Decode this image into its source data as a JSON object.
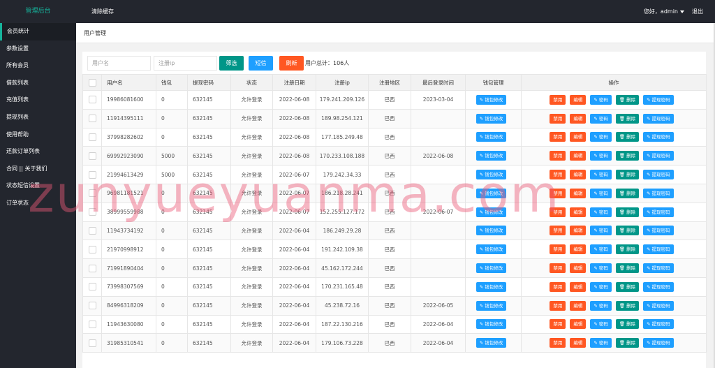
{
  "header": {
    "logo": "管理后台",
    "clear_cache": "清除缓存",
    "greeting": "您好，admin",
    "logout": "退出"
  },
  "sidebar": {
    "items": [
      {
        "label": "会员统计",
        "active": true
      },
      {
        "label": "参数设置"
      },
      {
        "label": "所有会员"
      },
      {
        "label": "借款列表"
      },
      {
        "label": "充值列表"
      },
      {
        "label": "提现列表"
      },
      {
        "label": "使用帮助"
      },
      {
        "label": "还款订单列表"
      },
      {
        "label": "合同 || 关于我们"
      },
      {
        "label": "状态短信设置"
      },
      {
        "label": "订单状态"
      }
    ]
  },
  "tab": {
    "title": "用户管理"
  },
  "toolbar": {
    "username_placeholder": "用户名",
    "ip_placeholder": "注册ip",
    "filter_label": "筛选",
    "sms_label": "短信",
    "refresh_label": "刷新",
    "total_text": "用户总计：106人"
  },
  "table": {
    "headers": [
      "用户名",
      "钱包",
      "提现密码",
      "状态",
      "注册日期",
      "注册ip",
      "注册地区",
      "最后登录时间",
      "钱包管理",
      "操作"
    ],
    "actions": {
      "wallet_edit": "钱包修改",
      "disable": "禁用",
      "edit": "编辑",
      "password": "密码",
      "delete": "删除",
      "withdraw_password": "提现密码"
    },
    "rows": [
      {
        "username": "19986081600",
        "wallet": "0",
        "withdraw_pwd": "632145",
        "status": "允许登录",
        "reg_date": "2022-06-08",
        "reg_ip": "179.241.209.126",
        "region": "巴西",
        "last_login": "2023-03-04"
      },
      {
        "username": "11914395111",
        "wallet": "0",
        "withdraw_pwd": "632145",
        "status": "允许登录",
        "reg_date": "2022-06-08",
        "reg_ip": "189.98.254.121",
        "region": "巴西",
        "last_login": ""
      },
      {
        "username": "37998282602",
        "wallet": "0",
        "withdraw_pwd": "632145",
        "status": "允许登录",
        "reg_date": "2022-06-08",
        "reg_ip": "177.185.249.48",
        "region": "巴西",
        "last_login": ""
      },
      {
        "username": "69992923090",
        "wallet": "5000",
        "withdraw_pwd": "632145",
        "status": "允许登录",
        "reg_date": "2022-06-08",
        "reg_ip": "170.233.108.188",
        "region": "巴西",
        "last_login": "2022-06-08"
      },
      {
        "username": "21994613429",
        "wallet": "5000",
        "withdraw_pwd": "632145",
        "status": "允许登录",
        "reg_date": "2022-06-07",
        "reg_ip": "179.242.34.33",
        "region": "巴西",
        "last_login": ""
      },
      {
        "username": "96981181521",
        "wallet": "0",
        "withdraw_pwd": "632145",
        "status": "允许登录",
        "reg_date": "2022-06-07",
        "reg_ip": "186.218.28.241",
        "region": "巴西",
        "last_login": ""
      },
      {
        "username": "38999559988",
        "wallet": "0",
        "withdraw_pwd": "632145",
        "status": "允许登录",
        "reg_date": "2022-06-07",
        "reg_ip": "152.255.127.172",
        "region": "巴西",
        "last_login": "2022-06-07"
      },
      {
        "username": "11943734192",
        "wallet": "0",
        "withdraw_pwd": "632145",
        "status": "允许登录",
        "reg_date": "2022-06-04",
        "reg_ip": "186.249.29.28",
        "region": "巴西",
        "last_login": ""
      },
      {
        "username": "21970998912",
        "wallet": "0",
        "withdraw_pwd": "632145",
        "status": "允许登录",
        "reg_date": "2022-06-04",
        "reg_ip": "191.242.109.38",
        "region": "巴西",
        "last_login": ""
      },
      {
        "username": "71991890404",
        "wallet": "0",
        "withdraw_pwd": "632145",
        "status": "允许登录",
        "reg_date": "2022-06-04",
        "reg_ip": "45.162.172.244",
        "region": "巴西",
        "last_login": ""
      },
      {
        "username": "73998307569",
        "wallet": "0",
        "withdraw_pwd": "632145",
        "status": "允许登录",
        "reg_date": "2022-06-04",
        "reg_ip": "170.231.165.48",
        "region": "巴西",
        "last_login": ""
      },
      {
        "username": "84996318209",
        "wallet": "0",
        "withdraw_pwd": "632145",
        "status": "允许登录",
        "reg_date": "2022-06-04",
        "reg_ip": "45.238.72.16",
        "region": "巴西",
        "last_login": "2022-06-05"
      },
      {
        "username": "11943630080",
        "wallet": "0",
        "withdraw_pwd": "632145",
        "status": "允许登录",
        "reg_date": "2022-06-04",
        "reg_ip": "187.22.130.216",
        "region": "巴西",
        "last_login": "2022-06-04"
      },
      {
        "username": "31985310541",
        "wallet": "0",
        "withdraw_pwd": "632145",
        "status": "允许登录",
        "reg_date": "2022-06-04",
        "reg_ip": "179.106.73.228",
        "region": "巴西",
        "last_login": "2022-06-04"
      }
    ]
  },
  "watermark": "zunyueyuanma.com",
  "colors": {
    "dark_bg": "#23262e",
    "accent_green": "#009688",
    "blue": "#1e9fff",
    "orange": "#ff5722"
  }
}
